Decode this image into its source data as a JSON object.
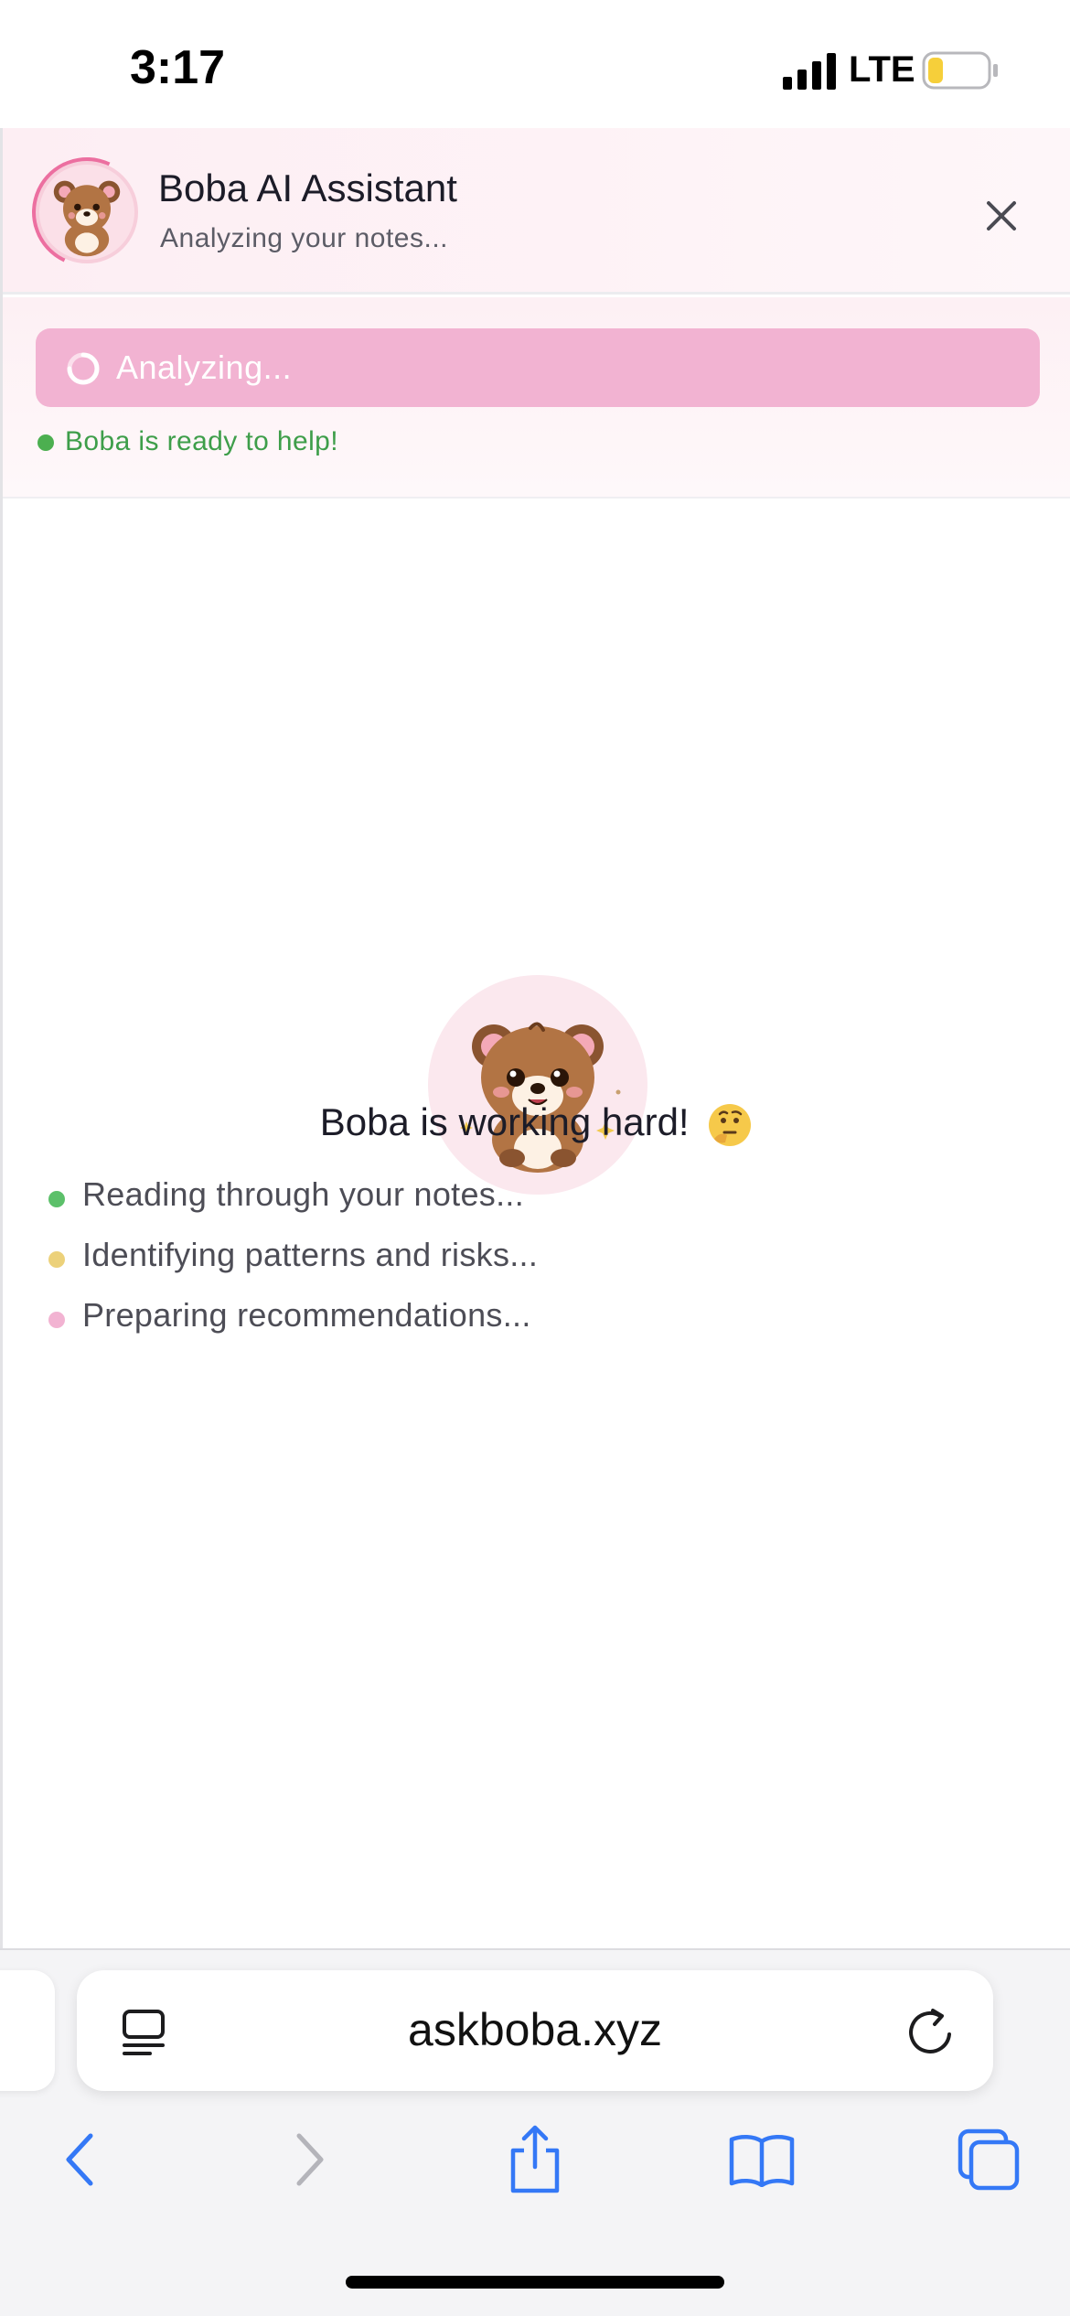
{
  "status_bar": {
    "time": "3:17",
    "network": "LTE",
    "signal_icon": "cellular-signal-icon",
    "battery_icon": "battery-low-icon",
    "battery_level": 0.25,
    "battery_color": "#f6cf3a"
  },
  "assistant": {
    "title": "Boba AI Assistant",
    "subtitle": "Analyzing your notes...",
    "avatar_icon": "bear-avatar-icon",
    "close_icon": "close-icon",
    "analyzing_button_label": "Analyzing...",
    "ready_status": "Boba is ready to help!",
    "colors": {
      "accent_pink": "#f2b3d2",
      "ring_pink": "#ec6fa0",
      "ready_green": "#3e9e4a"
    }
  },
  "working": {
    "title": "Boba is working hard!",
    "emoji": "thinking-face-icon",
    "bear_icon": "bear-mascot-icon",
    "steps": [
      {
        "text": "Reading through your notes...",
        "color": "#5cc06a"
      },
      {
        "text": "Identifying patterns and risks...",
        "color": "#ecd17a"
      },
      {
        "text": "Preparing recommendations...",
        "color": "#f2b3d2"
      }
    ]
  },
  "browser": {
    "url": "askboba.xyz",
    "reader_icon": "reader-mode-icon",
    "reload_icon": "reload-icon",
    "toolbar": [
      "back-icon",
      "forward-icon",
      "share-icon",
      "bookmarks-icon",
      "tabs-icon"
    ],
    "accent": "#3478f6"
  }
}
